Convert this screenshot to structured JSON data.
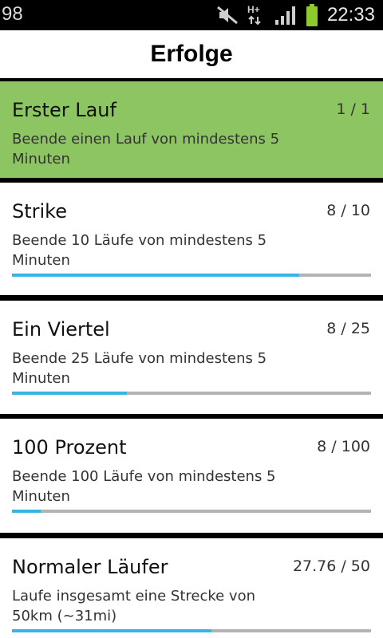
{
  "status_bar": {
    "left_text": "98",
    "time": "22:33",
    "network_label": "H+",
    "icons": [
      "mute-icon",
      "network-hplus-icon",
      "signal-icon",
      "battery-icon"
    ],
    "battery_color": "#8ccb2b"
  },
  "header": {
    "title": "Erfolge"
  },
  "colors": {
    "completed_card_bg": "#8dc563",
    "progress_fill": "#34b5e5",
    "progress_track": "#b3b3b3"
  },
  "achievements": [
    {
      "title": "Erster Lauf",
      "progress": "1 / 1",
      "description": "Beende einen Lauf von mindestens 5 Minuten",
      "completed": true,
      "fraction": 1.0
    },
    {
      "title": "Strike",
      "progress": "8 / 10",
      "description": "Beende 10 Läufe von mindestens 5 Minuten",
      "completed": false,
      "fraction": 0.8
    },
    {
      "title": "Ein Viertel",
      "progress": "8 / 25",
      "description": "Beende 25 Läufe von mindestens 5 Minuten",
      "completed": false,
      "fraction": 0.32
    },
    {
      "title": "100 Prozent",
      "progress": "8 / 100",
      "description": "Beende 100 Läufe von mindestens 5 Minuten",
      "completed": false,
      "fraction": 0.08
    },
    {
      "title": "Normaler Läufer",
      "progress": "27.76 / 50",
      "description": "Laufe insgesamt eine Strecke von 50km (~31mi)",
      "completed": false,
      "fraction": 0.5552
    }
  ]
}
